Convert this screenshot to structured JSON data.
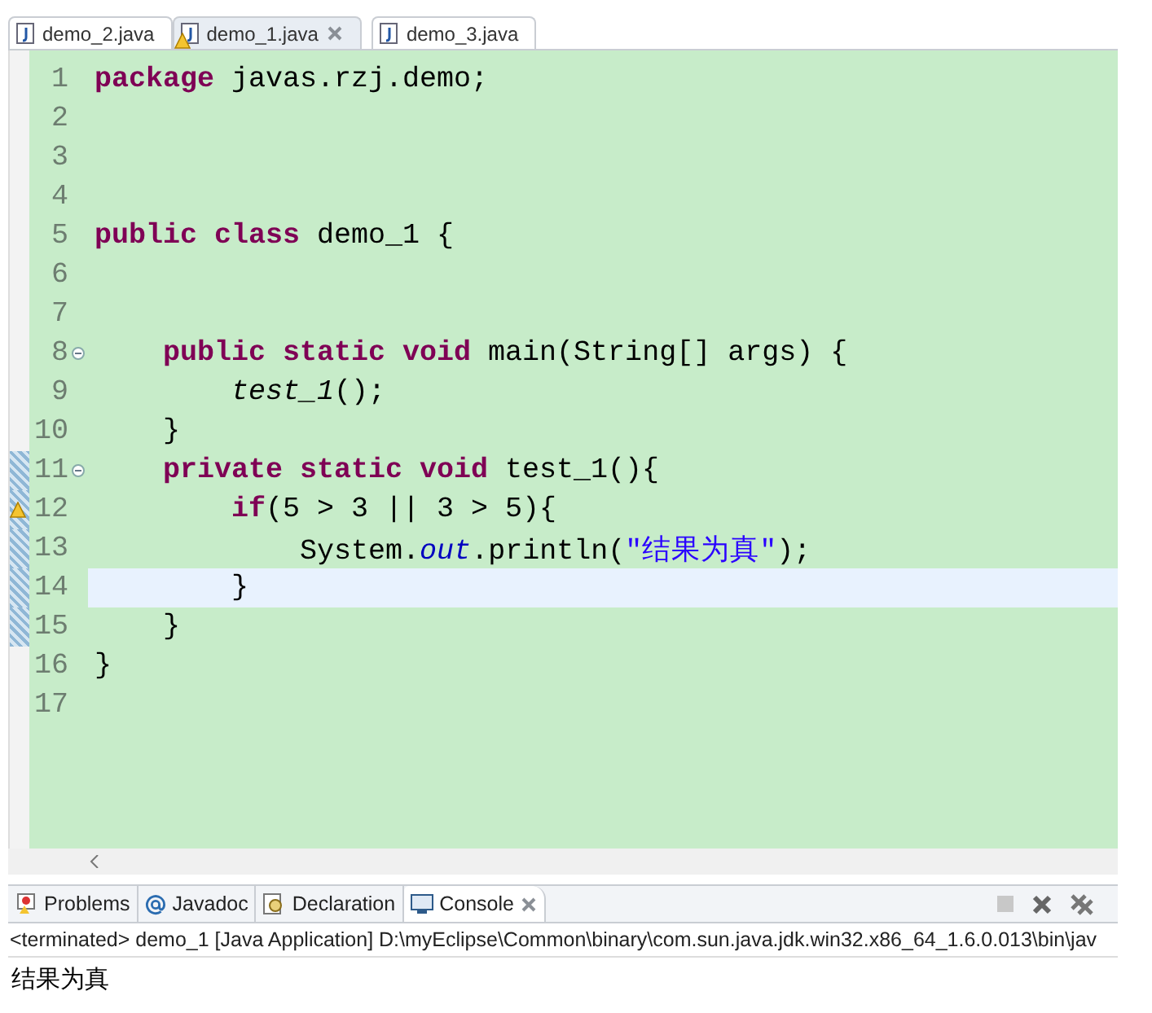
{
  "editor_tabs": [
    {
      "label": "demo_2.java",
      "selected": false
    },
    {
      "label": "demo_1.java",
      "selected": true,
      "warning": true,
      "closable": true
    },
    {
      "label": "demo_3.java",
      "selected": false
    }
  ],
  "code": {
    "lines": [
      {
        "number": "1",
        "tokens": [
          {
            "kind": "keyword",
            "text": "package"
          },
          {
            "kind": "plain",
            "text": " javas.rzj.demo;"
          }
        ]
      },
      {
        "number": "2"
      },
      {
        "number": "3"
      },
      {
        "number": "4"
      },
      {
        "number": "5",
        "tokens": [
          {
            "kind": "keyword",
            "text": "public class"
          },
          {
            "kind": "plain",
            "text": " demo_1 {"
          }
        ]
      },
      {
        "number": "6"
      },
      {
        "number": "7"
      },
      {
        "number": "8",
        "fold": true,
        "tokens": [
          {
            "kind": "keyword",
            "text": "    public static void"
          },
          {
            "kind": "plain",
            "text": " main(String[] args) {"
          }
        ]
      },
      {
        "number": "9",
        "tokens": [
          {
            "kind": "italic",
            "text": "        test_1"
          },
          {
            "kind": "plain",
            "text": "();"
          }
        ]
      },
      {
        "number": "10",
        "tokens": [
          {
            "kind": "plain",
            "text": "    }"
          }
        ]
      },
      {
        "number": "11",
        "fold": true,
        "changed": true,
        "tokens": [
          {
            "kind": "keyword",
            "text": "    private static void"
          },
          {
            "kind": "plain",
            "text": " test_1(){"
          }
        ]
      },
      {
        "number": "12",
        "warning": true,
        "changed": true,
        "tokens": [
          {
            "kind": "keyword",
            "text": "        if"
          },
          {
            "kind": "plain",
            "text": "(5 > 3 || 3 > 5){"
          }
        ]
      },
      {
        "number": "13",
        "changed": true,
        "tokens": [
          {
            "kind": "plain",
            "text": "            System."
          },
          {
            "kind": "field",
            "text": "out"
          },
          {
            "kind": "plain",
            "text": ".println("
          },
          {
            "kind": "string",
            "text": "\"结果为真\""
          },
          {
            "kind": "plain",
            "text": ");"
          }
        ]
      },
      {
        "number": "14",
        "current": true,
        "changed": true,
        "tokens": [
          {
            "kind": "plain",
            "text": "        }"
          }
        ]
      },
      {
        "number": "15",
        "changed": true,
        "tokens": [
          {
            "kind": "plain",
            "text": "    }"
          }
        ]
      },
      {
        "number": "16",
        "tokens": [
          {
            "kind": "plain",
            "text": "}"
          }
        ]
      },
      {
        "number": "17"
      }
    ]
  },
  "view_tabs": [
    {
      "label": "Problems",
      "kind": "problems",
      "selected": false
    },
    {
      "label": "Javadoc",
      "kind": "javadoc",
      "selected": false
    },
    {
      "label": "Declaration",
      "kind": "declaration",
      "selected": false
    },
    {
      "label": "Console",
      "kind": "console",
      "selected": true,
      "closable": true
    }
  ],
  "console": {
    "header": "<terminated> demo_1 [Java Application] D:\\myEclipse\\Common\\binary\\com.sun.java.jdk.win32.x86_64_1.6.0.013\\bin\\jav",
    "output": "结果为真"
  }
}
